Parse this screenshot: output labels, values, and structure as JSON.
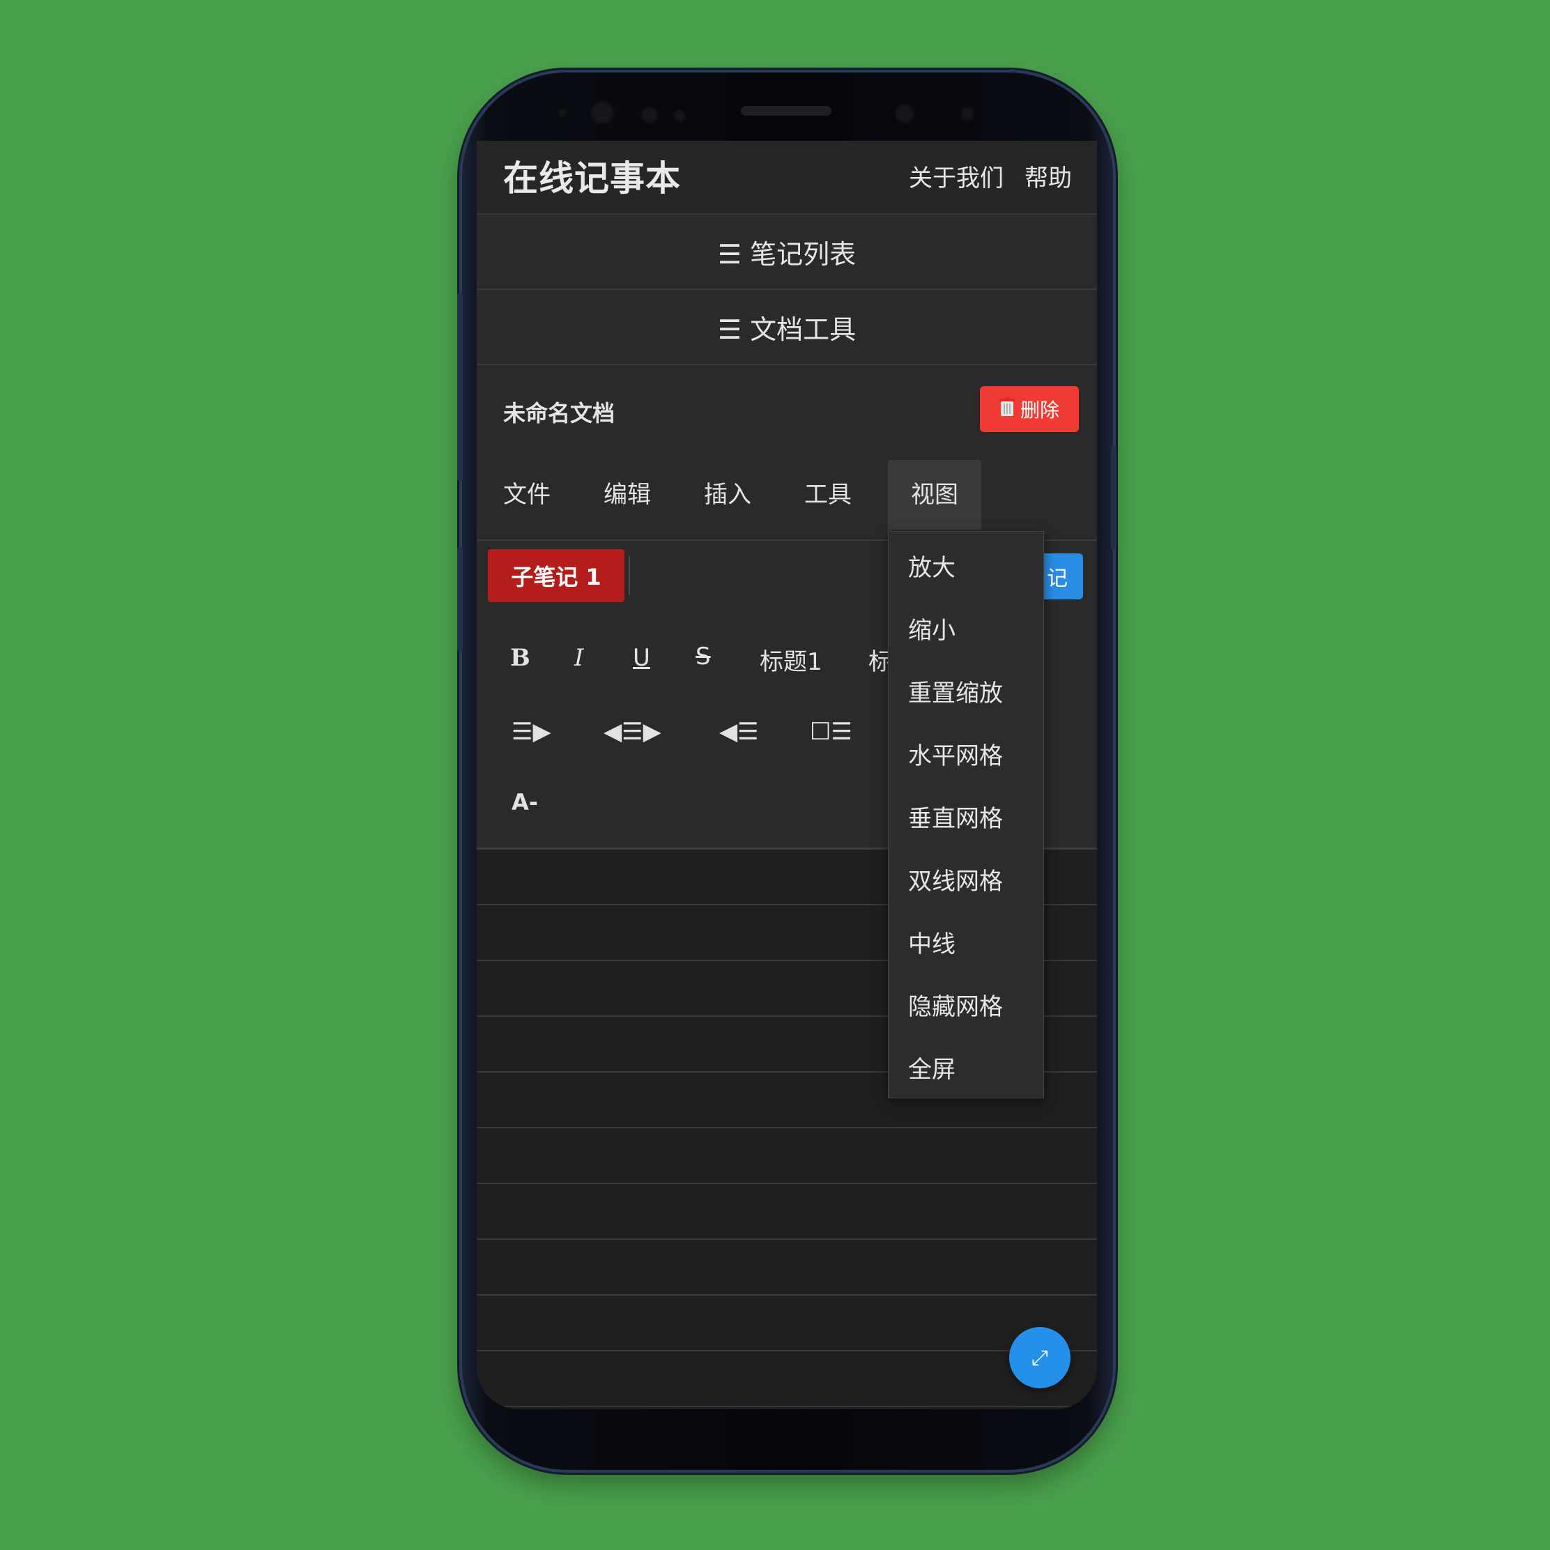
{
  "header": {
    "app_title": "在线记事本",
    "about_link": "关于我们",
    "help_link": "帮助"
  },
  "bars": {
    "note_list": "☰ 笔记列表",
    "doc_tools": "☰ 文档工具"
  },
  "document": {
    "title": "未命名文档",
    "delete_label": "删除",
    "delete_icon": "trash-icon"
  },
  "menu": {
    "items": [
      "文件",
      "编辑",
      "插入",
      "工具",
      "视图"
    ],
    "active": "视图"
  },
  "tabs": {
    "active_tab": "子笔记 1",
    "add_button_partial": "记"
  },
  "format": {
    "bold": "B",
    "italic": "I",
    "underline": "U",
    "strike": "S",
    "heading1": "标题1",
    "heading2_partial": "标",
    "indent": "☰▶",
    "center": "◀☰▶",
    "outdent": "◀☰",
    "checklist": "☐☰",
    "font_smaller": "A-"
  },
  "view_menu": [
    "放大",
    "缩小",
    "重置缩放",
    "水平网格",
    "垂直网格",
    "双线网格",
    "中线",
    "隐藏网格",
    "全屏"
  ],
  "fab": {
    "icon": "expand-icon",
    "glyph": "⤢"
  },
  "colors": {
    "background": "#49a04b",
    "delete": "#f03b34",
    "tab_active": "#b51c1c",
    "accent": "#2490ea"
  }
}
